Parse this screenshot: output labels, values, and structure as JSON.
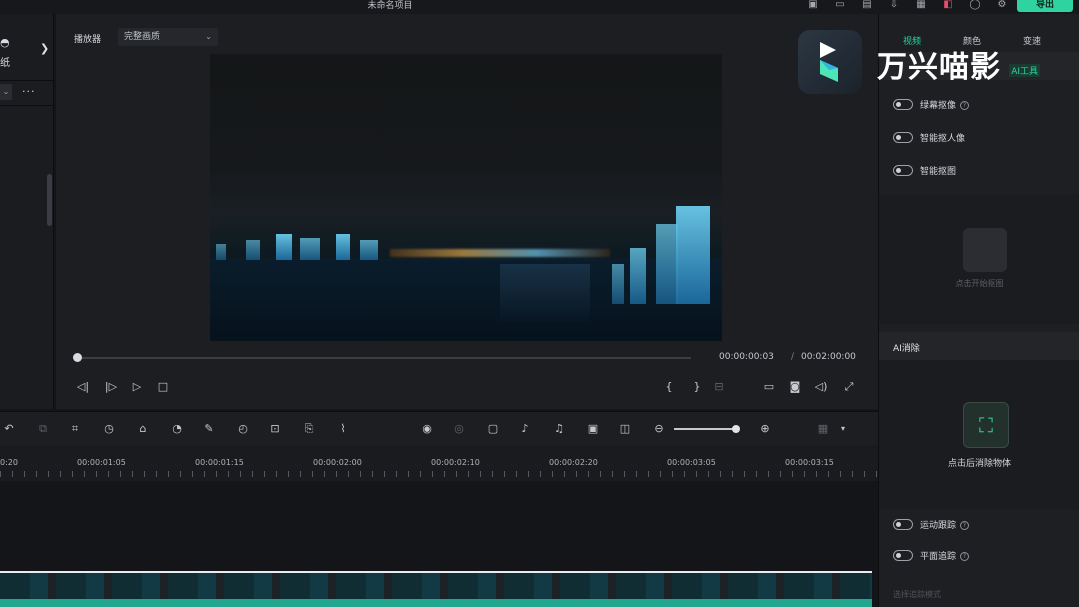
{
  "titlebar": {
    "title": "未命名项目",
    "export_label": "导出",
    "icons": [
      "status-icon",
      "layout-icon",
      "save-icon",
      "download-icon",
      "grid-icon",
      "cart-icon",
      "account-icon",
      "settings-icon"
    ]
  },
  "left_panel": {
    "label": "纸",
    "chevron": "❯",
    "more": "···"
  },
  "player": {
    "label": "播放器",
    "quality": "完整画质",
    "current_time": "00:00:00:03",
    "separator": "/",
    "total_time": "00:02:00:00",
    "progress": 0.0
  },
  "brand": {
    "name": "万兴喵影",
    "accent": "#2fd39f"
  },
  "right_panel": {
    "tabs": [
      {
        "label": "视频",
        "active": true
      },
      {
        "label": "颜色",
        "active": false
      },
      {
        "label": "变速",
        "active": false
      }
    ],
    "ai_tools_label": "AI工具",
    "toggles_top": [
      {
        "label": "绿幕抠像",
        "help": true
      },
      {
        "label": "智能抠人像",
        "help": false
      },
      {
        "label": "智能抠图",
        "help": false
      }
    ],
    "matte_hint": "点击开始抠图",
    "ai_erase_title": "AI消除",
    "ai_erase_action": "点击后消除物体",
    "toggles_bottom": [
      {
        "label": "运动跟踪",
        "help": true
      },
      {
        "label": "平面追踪",
        "help": true
      }
    ],
    "bottom_hint": "选择追踪模式"
  },
  "timeline": {
    "ruler_labels": [
      "0:20",
      "00:00:01:05",
      "00:00:01:15",
      "00:00:02:00",
      "00:00:02:10",
      "00:00:02:20",
      "00:00:03:05",
      "00:00:03:15"
    ],
    "zoom_level": 0.95
  }
}
